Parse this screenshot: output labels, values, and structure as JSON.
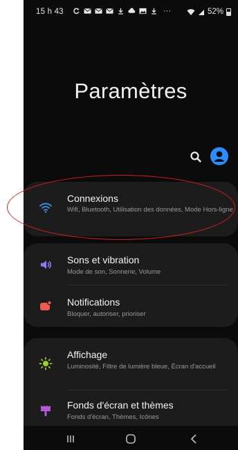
{
  "status_bar": {
    "time": "15 h 43",
    "notification_icons": [
      "sync-icon",
      "mail-icon",
      "mail-icon",
      "mail-icon",
      "download-icon",
      "cloud-icon",
      "gallery-icon",
      "download-icon",
      "more-icon"
    ],
    "overflow": "···",
    "battery_percent": "52%"
  },
  "header": {
    "title": "Paramètres"
  },
  "toolbar": {
    "search_icon": "search-icon",
    "profile_icon": "account-icon",
    "accent": "#2d8cff"
  },
  "groups": [
    {
      "items": [
        {
          "label": "Connexions",
          "sub": "Wifi, Bluetooth, Utilisation des données, Mode Hors-ligne",
          "icon": "wifi-icon",
          "color": "#3b8fe8"
        }
      ]
    },
    {
      "items": [
        {
          "label": "Sons et vibration",
          "sub": "Mode de son, Sonnerie, Volume",
          "icon": "volume-icon",
          "color": "#8b7bf5"
        },
        {
          "label": "Notifications",
          "sub": "Bloquer, autoriser, prioriser",
          "icon": "notification-icon",
          "color": "#f05b4f"
        }
      ]
    },
    {
      "items": [
        {
          "label": "Affichage",
          "sub": "Luminosité, Filtre de lumière bleue, Écran d'accueil",
          "icon": "brightness-icon",
          "color": "#9ad12b"
        },
        {
          "label": "Fonds d'écran et thèmes",
          "sub": "Fonds d'écran, Thèmes, Icônes",
          "icon": "paintbrush-icon",
          "color": "#b45ad8"
        }
      ]
    }
  ],
  "nav_bar": {
    "buttons": [
      "recents-icon",
      "home-icon",
      "back-icon"
    ]
  },
  "annotation_color": "#d61f1f"
}
